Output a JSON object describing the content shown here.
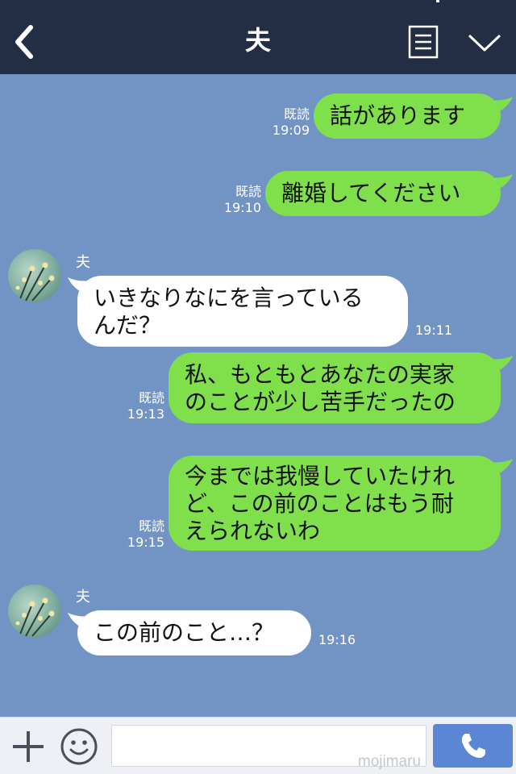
{
  "header": {
    "title": "夫",
    "icons": [
      "back-icon",
      "notes-icon",
      "chevron-down-icon"
    ]
  },
  "messages": [
    {
      "side": "sent",
      "text": "話があります",
      "read": "既読",
      "time": "19:09"
    },
    {
      "side": "sent",
      "text": "離婚してください",
      "read": "既読",
      "time": "19:10"
    },
    {
      "side": "received",
      "sender": "夫",
      "text": "いきなりなにを言っている\nんだ？",
      "time": "19:11"
    },
    {
      "side": "sent",
      "text": "私、もともとあなたの実家\nのことが少し苦手だったの",
      "read": "既読",
      "time": "19:13"
    },
    {
      "side": "sent",
      "text": "今までは我慢していたけれ\nど、この前のことはもう耐\nえられないわ",
      "read": "既読",
      "time": "19:15"
    },
    {
      "side": "received",
      "sender": "夫",
      "text": "この前のこと…？",
      "time": "19:16"
    }
  ],
  "input_bar": {
    "message_value": "",
    "watermark": "mojimaru",
    "icons": [
      "plus-icon",
      "smile-icon",
      "phone-icon"
    ]
  },
  "colors": {
    "header_bg": "#232d44",
    "chat_bg": "#7194c5",
    "sent_bubble": "#7fe04b",
    "received_bubble": "#ffffff",
    "call_button": "#5a86d3"
  }
}
